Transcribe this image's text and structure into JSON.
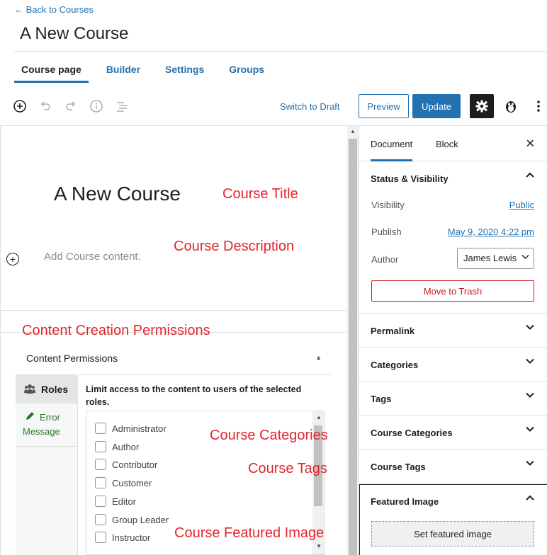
{
  "header": {
    "back_link": "← Back to Courses",
    "title": "A New Course",
    "tabs": [
      "Course page",
      "Builder",
      "Settings",
      "Groups"
    ]
  },
  "toolbar": {
    "switch_draft": "Switch to Draft",
    "preview": "Preview",
    "update": "Update"
  },
  "editor": {
    "course_title": "A New Course",
    "placeholder": "Add Course content."
  },
  "annotations": {
    "course_title": "Course Title",
    "course_description": "Course Description",
    "content_creation_permissions": "Content Creation Permissions",
    "course_categories": "Course Categories",
    "course_tags": "Course Tags",
    "course_featured_image": "Course Featured Image"
  },
  "permissions": {
    "title": "Content Permissions",
    "roles_tab": "Roles",
    "error_tab": "Error Message",
    "limit_text": "Limit access to the content to users of the selected roles.",
    "roles": [
      "Administrator",
      "Author",
      "Contributor",
      "Customer",
      "Editor",
      "Group Leader",
      "Instructor"
    ]
  },
  "sidebar": {
    "tabs": [
      "Document",
      "Block"
    ],
    "status": {
      "title": "Status & Visibility",
      "visibility_label": "Visibility",
      "visibility_value": "Public",
      "publish_label": "Publish",
      "publish_value": "May 9, 2020 4:22 pm",
      "author_label": "Author",
      "author_value": "James Lewis",
      "trash": "Move to Trash"
    },
    "panels": [
      "Permalink",
      "Categories",
      "Tags",
      "Course Categories",
      "Course Tags"
    ],
    "featured": {
      "title": "Featured Image",
      "button": "Set featured image"
    }
  }
}
